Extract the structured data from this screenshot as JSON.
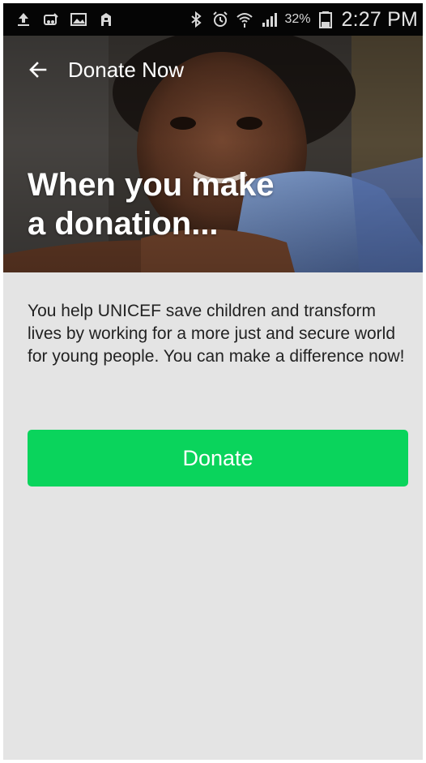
{
  "status_bar": {
    "left_icons": [
      "upload-icon",
      "voicemail-icon",
      "image-icon",
      "app-icon"
    ],
    "right_icons": [
      "bluetooth-icon",
      "alarm-icon",
      "wifi-icon",
      "signal-icon"
    ],
    "battery_percent": "32%",
    "time": "2:27 PM"
  },
  "app_bar": {
    "back_icon": "arrow-left-icon",
    "title": "Donate Now"
  },
  "hero": {
    "headline_line1": "When you make",
    "headline_line2": "a donation..."
  },
  "main": {
    "description": "You help UNICEF save children and transform lives by working for a more just and secure world for young people. You can make a difference now!",
    "donate_label": "Donate"
  },
  "colors": {
    "donate_button": "#0ad45c",
    "background": "#e4e4e4",
    "status_bar": "#050505"
  }
}
